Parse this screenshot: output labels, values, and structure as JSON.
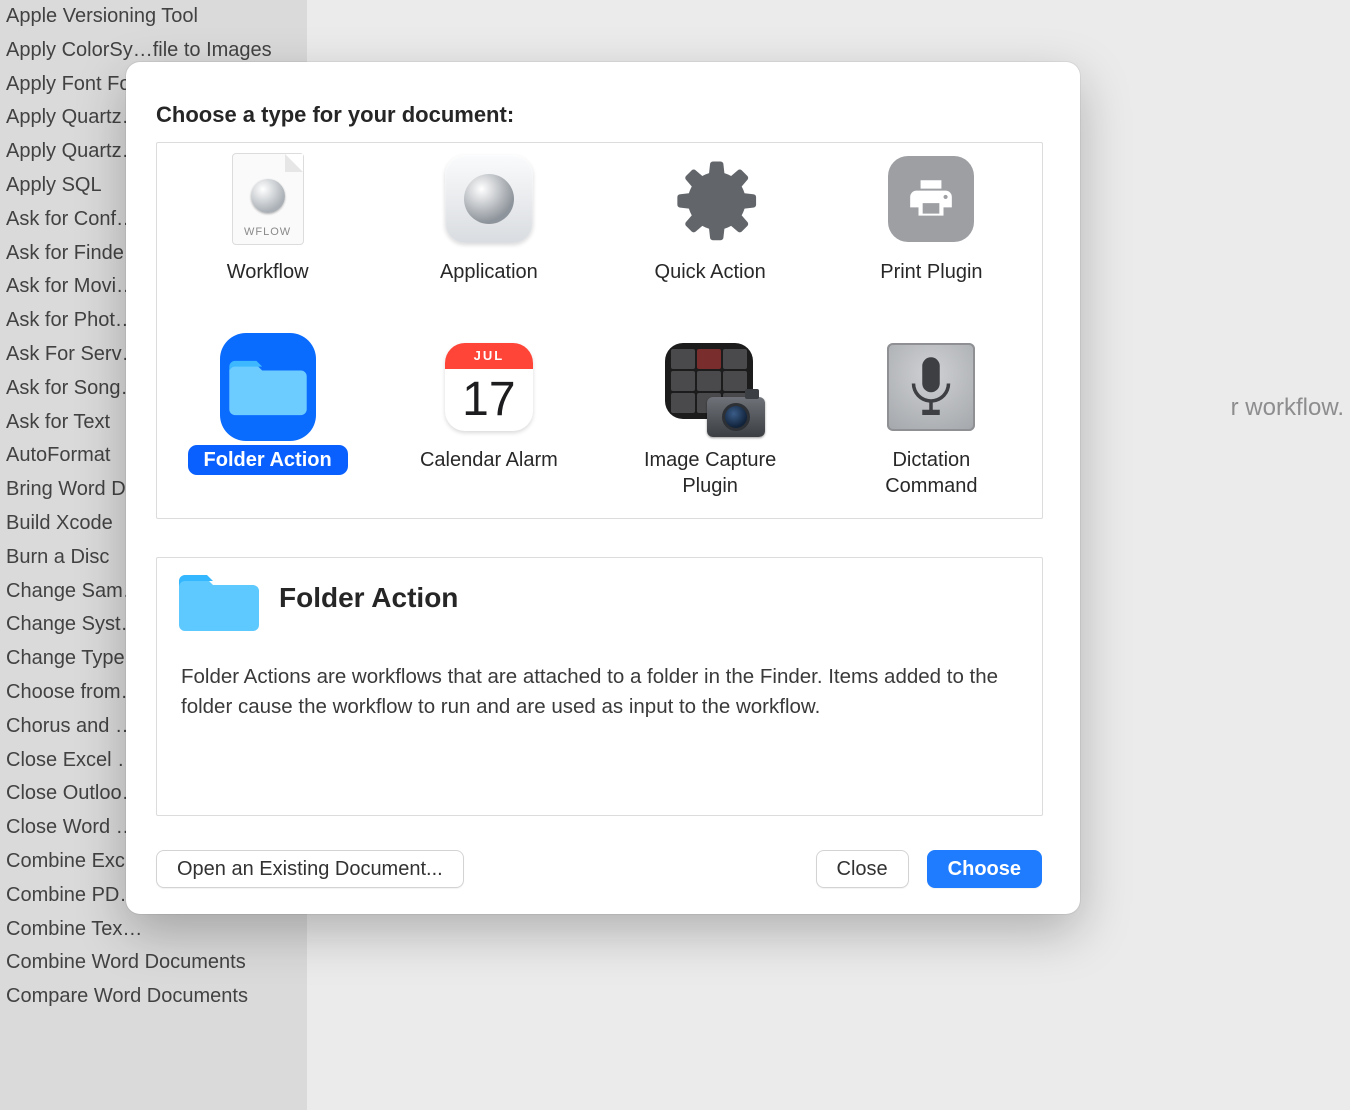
{
  "sidebar": {
    "items": [
      "Apple Versioning Tool",
      "Apply ColorSy…file to Images",
      "Apply Font Fo…rd Documents",
      "Apply Quartz…",
      "Apply Quartz…",
      "Apply SQL",
      "Ask for Conf…",
      "Ask for Finde…",
      "Ask for Movi…",
      "Ask for Phot…",
      "Ask For Serv…",
      "Ask for Song…",
      "Ask for Text",
      "AutoFormat",
      "Bring Word D…",
      "Build Xcode",
      "Burn a Disc",
      "Change Sam…",
      "Change Syst…",
      "Change Type…",
      "Choose from…",
      "Chorus and …",
      "Close Excel …",
      "Close Outloo…",
      "Close Word …",
      "Combine Exc…",
      "Combine PD…",
      "Combine Tex…",
      "Combine Word Documents",
      "Compare Word Documents"
    ]
  },
  "canvas": {
    "hint_suffix": "r workflow."
  },
  "sheet": {
    "title": "Choose a type for your document:",
    "types": [
      {
        "id": "workflow",
        "label": "Workflow",
        "selected": false
      },
      {
        "id": "application",
        "label": "Application",
        "selected": false
      },
      {
        "id": "quick-action",
        "label": "Quick Action",
        "selected": false
      },
      {
        "id": "print-plugin",
        "label": "Print Plugin",
        "selected": false
      },
      {
        "id": "folder-action",
        "label": "Folder Action",
        "selected": true
      },
      {
        "id": "calendar-alarm",
        "label": "Calendar Alarm",
        "selected": false
      },
      {
        "id": "image-capture",
        "label": "Image Capture\nPlugin",
        "selected": false
      },
      {
        "id": "dictation",
        "label": "Dictation\nCommand",
        "selected": false
      }
    ],
    "calendar": {
      "month": "JUL",
      "day": "17"
    },
    "workflow_badge": "WFLOW",
    "detail": {
      "title": "Folder Action",
      "description": "Folder Actions are workflows that are attached to a folder in the Finder. Items added to the folder cause the workflow to run and are used as input to the workflow."
    },
    "buttons": {
      "open_existing": "Open an Existing Document...",
      "close": "Close",
      "choose": "Choose"
    }
  }
}
